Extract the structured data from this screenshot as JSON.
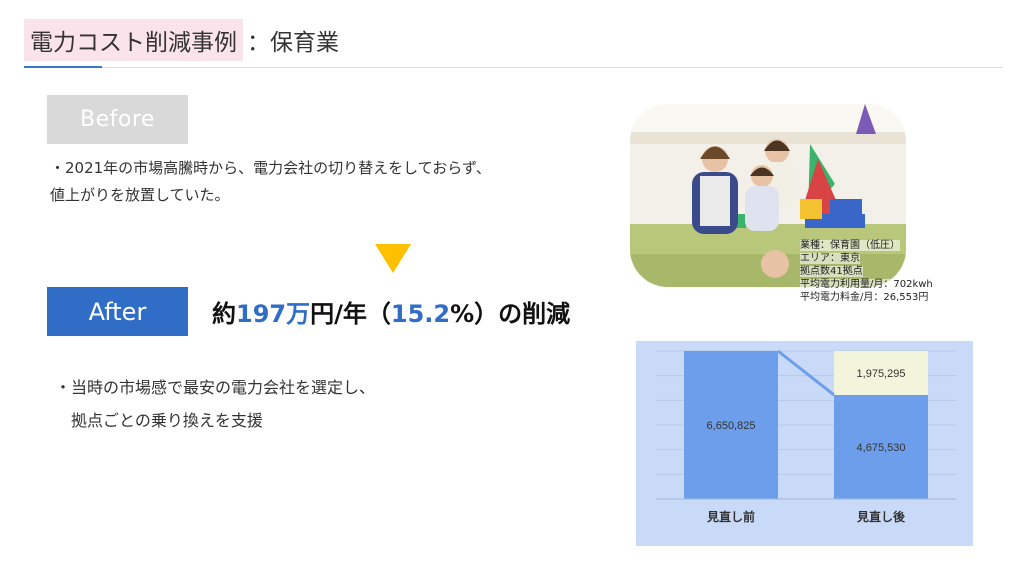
{
  "header": {
    "title_main": "電力コスト削減事例",
    "title_colon": "：",
    "title_sub": "保育業"
  },
  "before": {
    "label": "Before",
    "text_line1": "・2021年の市場高騰時から、電力会社の切り替えをしておらず、",
    "text_line2": "値上がりを放置していた。"
  },
  "after": {
    "label": "After",
    "headline_pre": "約",
    "headline_amount": "197万",
    "headline_mid": "円/年（",
    "headline_pct": "15.2",
    "headline_post": "%）の削減",
    "text_line1": "・当時の市場感で最安の電力会社を選定し、",
    "text_line2": "拠点ごとの乗り換えを支援"
  },
  "photo": {
    "info_lines": [
      "業種：保育園（低圧）",
      "エリア：東京",
      "拠点数41拠点",
      "平均電力利用量/月：702kwh",
      "平均電力料金/月：26,553円"
    ]
  },
  "chart_data": {
    "type": "bar",
    "stacked": true,
    "categories": [
      "見直し前",
      "見直し後"
    ],
    "series": [
      {
        "values": [
          6650825,
          4675530
        ],
        "color": "#6d9eeb"
      },
      {
        "values": [
          0,
          1975295
        ],
        "color": "#f2f5dc"
      }
    ],
    "data_labels": [
      "6,650,825",
      "4,675,530",
      "1,975,295"
    ],
    "ylim": [
      0,
      6650825
    ],
    "grid": true,
    "background": "#c9daf8"
  },
  "colors": {
    "accent_blue": "#2f6dc6",
    "arrow_yellow": "#ffc000",
    "title_highlight": "#fbe3ec"
  }
}
